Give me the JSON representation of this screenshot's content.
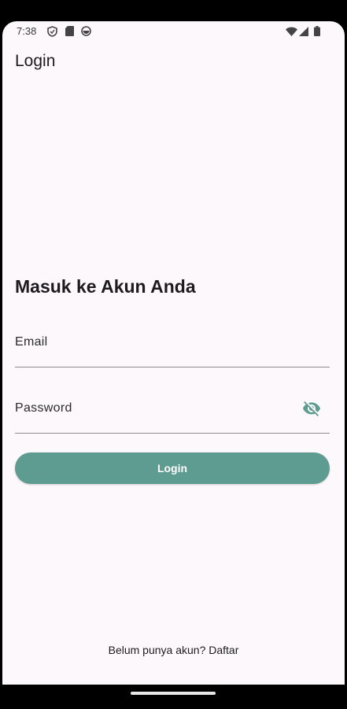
{
  "status_bar": {
    "time": "7:38",
    "left_icons": [
      "shield-icon",
      "sim-card-icon",
      "circle-app-icon"
    ],
    "right_icons": [
      "wifi-icon",
      "cell-signal-icon",
      "battery-icon"
    ]
  },
  "app_bar": {
    "title": "Login"
  },
  "form": {
    "heading": "Masuk ke Akun Anda",
    "email_label": "Email",
    "password_label": "Password",
    "password_toggle_icon": "visibility-off-icon",
    "login_button_label": "Login"
  },
  "footer": {
    "register_text": "Belum punya akun? Daftar"
  },
  "colors": {
    "accent": "#5e9b91",
    "background": "#fdf8fc"
  }
}
